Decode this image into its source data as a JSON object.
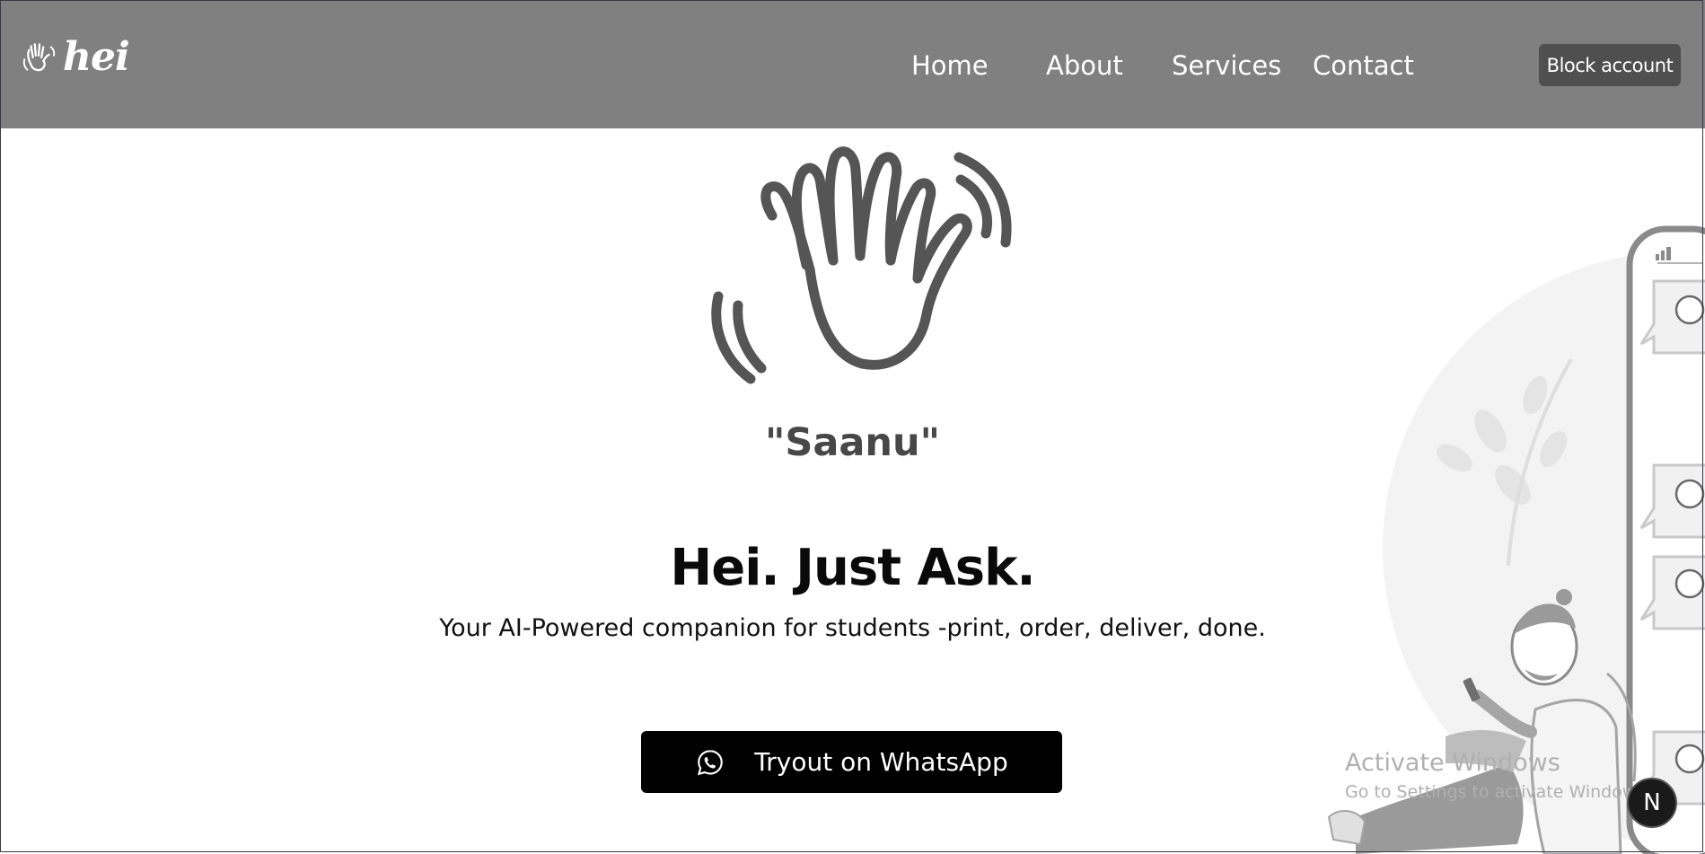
{
  "header": {
    "logo_text": "hei",
    "nav": [
      {
        "label": "Home"
      },
      {
        "label": "About"
      },
      {
        "label": "Services"
      },
      {
        "label": "Contact"
      }
    ],
    "block_account_label": "Block account"
  },
  "hero": {
    "name_quote": "\"Saanu\"",
    "headline": "Hei. Just Ask.",
    "subtitle": "Your AI-Powered companion for students -print, order, deliver, done.",
    "cta_label": "Tryout on WhatsApp",
    "cta_icon": "whatsapp-icon"
  },
  "overlay": {
    "activate_title": "Activate Windows",
    "activate_sub": "Go to Settings to activate Windows.",
    "badge_letter": "N"
  },
  "colors": {
    "header_bg": "#808080",
    "block_button_bg": "#4f4f4f",
    "cta_bg": "#000000",
    "hand_stroke": "#555555"
  }
}
